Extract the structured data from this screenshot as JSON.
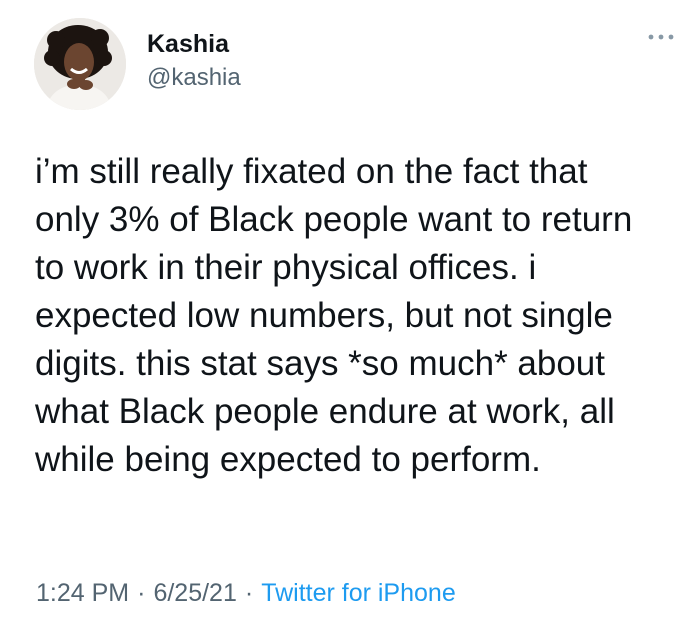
{
  "author": {
    "display_name": "Kashia",
    "handle": "@kashia"
  },
  "icons": {
    "avatar": "profile-photo",
    "more": "more-options-ellipsis-icon"
  },
  "tweet": {
    "text_lines": [
      "i’m still really fixated on the fact that",
      "only 3% of Black people want to return",
      "to work in their physical offices. i",
      "expected low numbers, but not single",
      "digits. this stat says *so much* about",
      "what Black people endure at work, all",
      "while being expected to perform."
    ]
  },
  "meta": {
    "time": "1:24 PM",
    "date": "6/25/21",
    "source": "Twitter for iPhone",
    "separator": "·"
  },
  "colors": {
    "text": "#0f1419",
    "secondary": "#536471",
    "link": "#1d9bf0"
  }
}
